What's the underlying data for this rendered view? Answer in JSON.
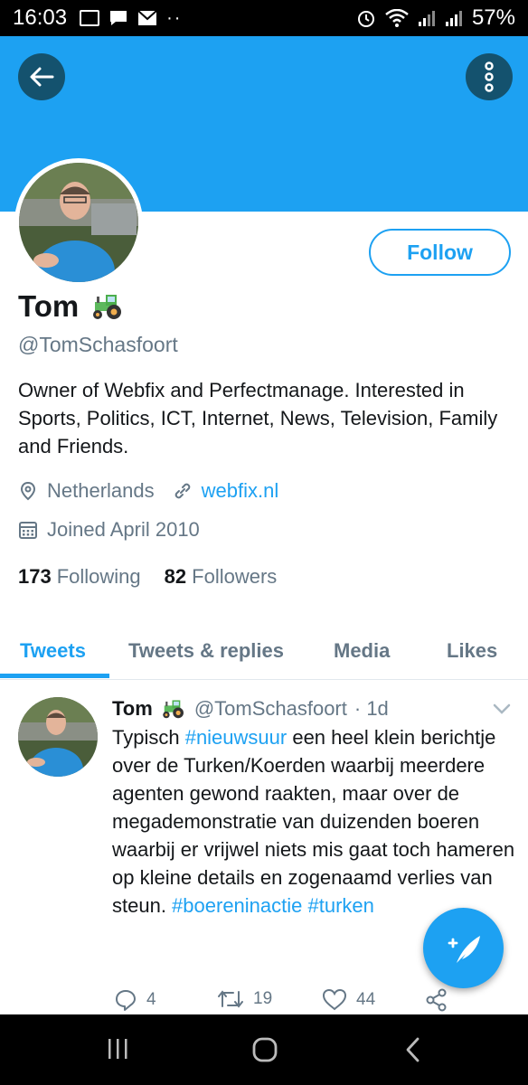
{
  "status_bar": {
    "time": "16:03",
    "battery": "57%",
    "extra": "··"
  },
  "profile": {
    "name": "Tom",
    "handle": "@TomSchasfoort",
    "bio": "Owner of Webfix and Perfectmanage. Interested in Sports, Politics, ICT, Internet, News, Television, Family and Friends.",
    "location": "Netherlands",
    "website": "webfix.nl",
    "joined": "Joined April 2010",
    "following_count": "173",
    "following_label": "Following",
    "followers_count": "82",
    "followers_label": "Followers",
    "follow_label": "Follow"
  },
  "tabs": [
    {
      "label": "Tweets",
      "active": true
    },
    {
      "label": "Tweets & replies",
      "active": false
    },
    {
      "label": "Media",
      "active": false
    },
    {
      "label": "Likes",
      "active": false
    }
  ],
  "tweet": {
    "name": "Tom",
    "handle": "@TomSchasfoort",
    "time": "· 1d",
    "text_1": "Typisch ",
    "hashtag_1": "#nieuwsuur",
    "text_2": " een heel klein berichtje over de Turken/Koerden waarbij meerdere agenten gewond raakten, maar over de megademonstratie van duizenden boeren waarbij er vrijwel niets mis gaat toch hameren op kleine details en zogenaamd verlies van steun. ",
    "hashtag_2": "#boereninactie",
    "hashtag_3": "#turken",
    "replies": "4",
    "retweets": "19",
    "likes": "44"
  },
  "colors": {
    "accent": "#1da1f2",
    "banner": "#1da1f2",
    "round_button": "#14526e",
    "muted_text": "#657786"
  },
  "icons": [
    "back-arrow-icon",
    "more-vertical-icon",
    "tractor-icon",
    "location-pin-icon",
    "link-icon",
    "calendar-icon",
    "chevron-down-icon",
    "reply-icon",
    "retweet-icon",
    "like-icon",
    "share-icon",
    "compose-icon",
    "recents-icon",
    "home-icon",
    "back-icon"
  ]
}
